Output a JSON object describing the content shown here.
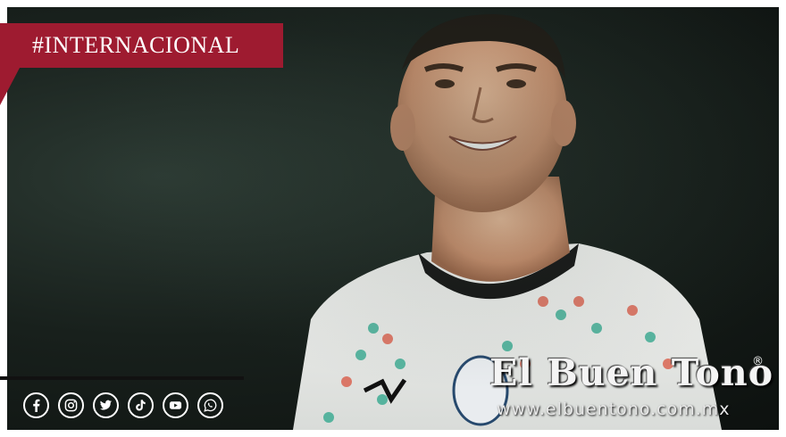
{
  "category": {
    "label": "#INTERNACIONAL",
    "color": "#9e1b30"
  },
  "social_links": [
    {
      "icon": "facebook-icon"
    },
    {
      "icon": "instagram-icon"
    },
    {
      "icon": "twitter-icon"
    },
    {
      "icon": "tiktok-icon"
    },
    {
      "icon": "youtube-icon"
    },
    {
      "icon": "whatsapp-icon"
    }
  ],
  "brand": {
    "name": "El Buen Tono",
    "registered_mark": "®",
    "url": "www.elbuentono.com.mx"
  },
  "photo": {
    "subject": "smiling football player in white patterned jersey"
  }
}
